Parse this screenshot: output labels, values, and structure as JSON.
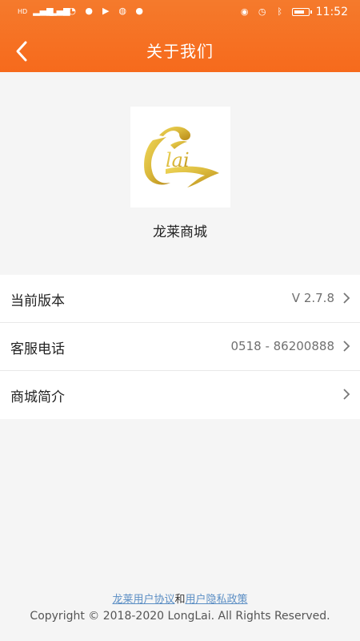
{
  "status_bar": {
    "left_icons": [
      "sim-icon",
      "signal-icon",
      "signal-icon",
      "wifi-icon",
      "wechat-icon",
      "play-icon",
      "globe-icon",
      "qq-icon"
    ],
    "hd_label_1": "HD",
    "hd_label_2": "HD",
    "time": "11:52",
    "right_icons": [
      "eye-icon",
      "alarm-icon",
      "bluetooth-icon",
      "battery-icon"
    ]
  },
  "header": {
    "title": "关于我们",
    "back_icon": "chevron-left-icon"
  },
  "app": {
    "name": "龙莱商城",
    "logo_text": "lai"
  },
  "menu": {
    "items": [
      {
        "label": "当前版本",
        "value": "V 2.7.8"
      },
      {
        "label": "客服电话",
        "value": "0518 - 86200888"
      },
      {
        "label": "商城简介",
        "value": ""
      }
    ]
  },
  "footer": {
    "user_agreement": "龙莱用户协议",
    "conjunction": "和",
    "privacy_policy": "用户隐私政策",
    "copyright": "Copyright © 2018-2020 LongLai. All Rights Reserved."
  },
  "colors": {
    "header": "#f66a1c",
    "link": "#5b8ec4",
    "background": "#f5f5f5"
  }
}
